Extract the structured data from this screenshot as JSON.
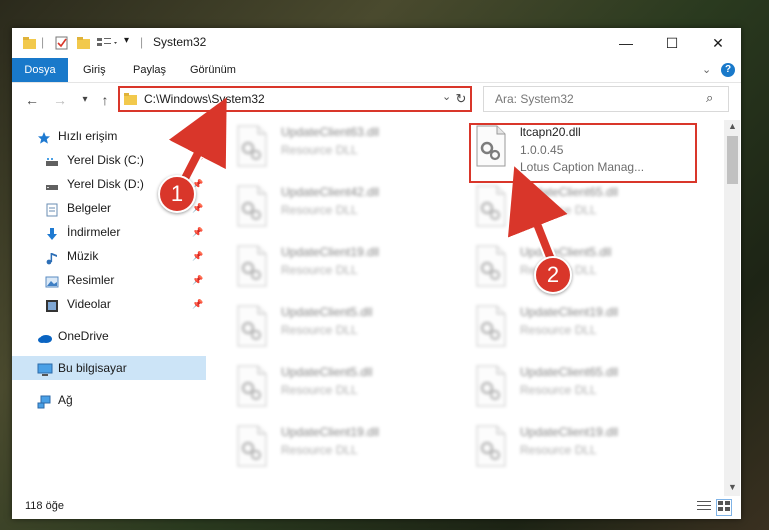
{
  "window": {
    "title": "System32",
    "controls": {
      "minimize": "—",
      "maximize": "☐",
      "close": "✕"
    }
  },
  "ribbon": {
    "tabs": [
      "Dosya",
      "Giriş",
      "Paylaş",
      "Görünüm"
    ],
    "active_tab": "Dosya"
  },
  "address": {
    "path": "C:\\Windows\\System32",
    "search_placeholder": "Ara: System32"
  },
  "sidebar": {
    "quick_access": "Hızlı erişim",
    "items": [
      {
        "label": "Yerel Disk (C:)",
        "icon": "drive-icon",
        "pinned": true
      },
      {
        "label": "Yerel Disk (D:)",
        "icon": "drive-icon",
        "pinned": true
      },
      {
        "label": "Belgeler",
        "icon": "documents-icon",
        "pinned": true
      },
      {
        "label": "İndirmeler",
        "icon": "download-icon",
        "pinned": true
      },
      {
        "label": "Müzik",
        "icon": "music-icon",
        "pinned": true
      },
      {
        "label": "Resimler",
        "icon": "pictures-icon",
        "pinned": true
      },
      {
        "label": "Videolar",
        "icon": "videos-icon",
        "pinned": true
      }
    ],
    "onedrive": "OneDrive",
    "this_pc": "Bu bilgisayar",
    "network": "Ağ"
  },
  "files": {
    "left_column": [
      {
        "name": "UpdateClient63.dll",
        "type": "Resource DLL"
      },
      {
        "name": "UpdateClient42.dll",
        "type": "Resource DLL"
      },
      {
        "name": "UpdateClient19.dll",
        "type": "Resource DLL"
      },
      {
        "name": "UpdateClient5.dll",
        "type": "Resource DLL"
      },
      {
        "name": "UpdateClient5.dll",
        "type": "Resource DLL"
      },
      {
        "name": "UpdateClient19.dll",
        "type": "Resource DLL"
      }
    ],
    "right_column": [
      {
        "name": "ltcapn20.dll",
        "version": "1.0.0.45",
        "description": "Lotus Caption Manag..."
      },
      {
        "name": "UpdateClient65.dll",
        "type": "Resource DLL"
      },
      {
        "name": "UpdateClient5.dll",
        "type": "Resource DLL"
      },
      {
        "name": "UpdateClient19.dll",
        "type": "Resource DLL"
      },
      {
        "name": "UpdateClient65.dll",
        "type": "Resource DLL"
      },
      {
        "name": "UpdateClient19.dll",
        "type": "Resource DLL"
      }
    ]
  },
  "status": {
    "item_count": "118 öğe"
  },
  "annotations": {
    "badge_1": "1",
    "badge_2": "2",
    "color": "#d9362a"
  }
}
